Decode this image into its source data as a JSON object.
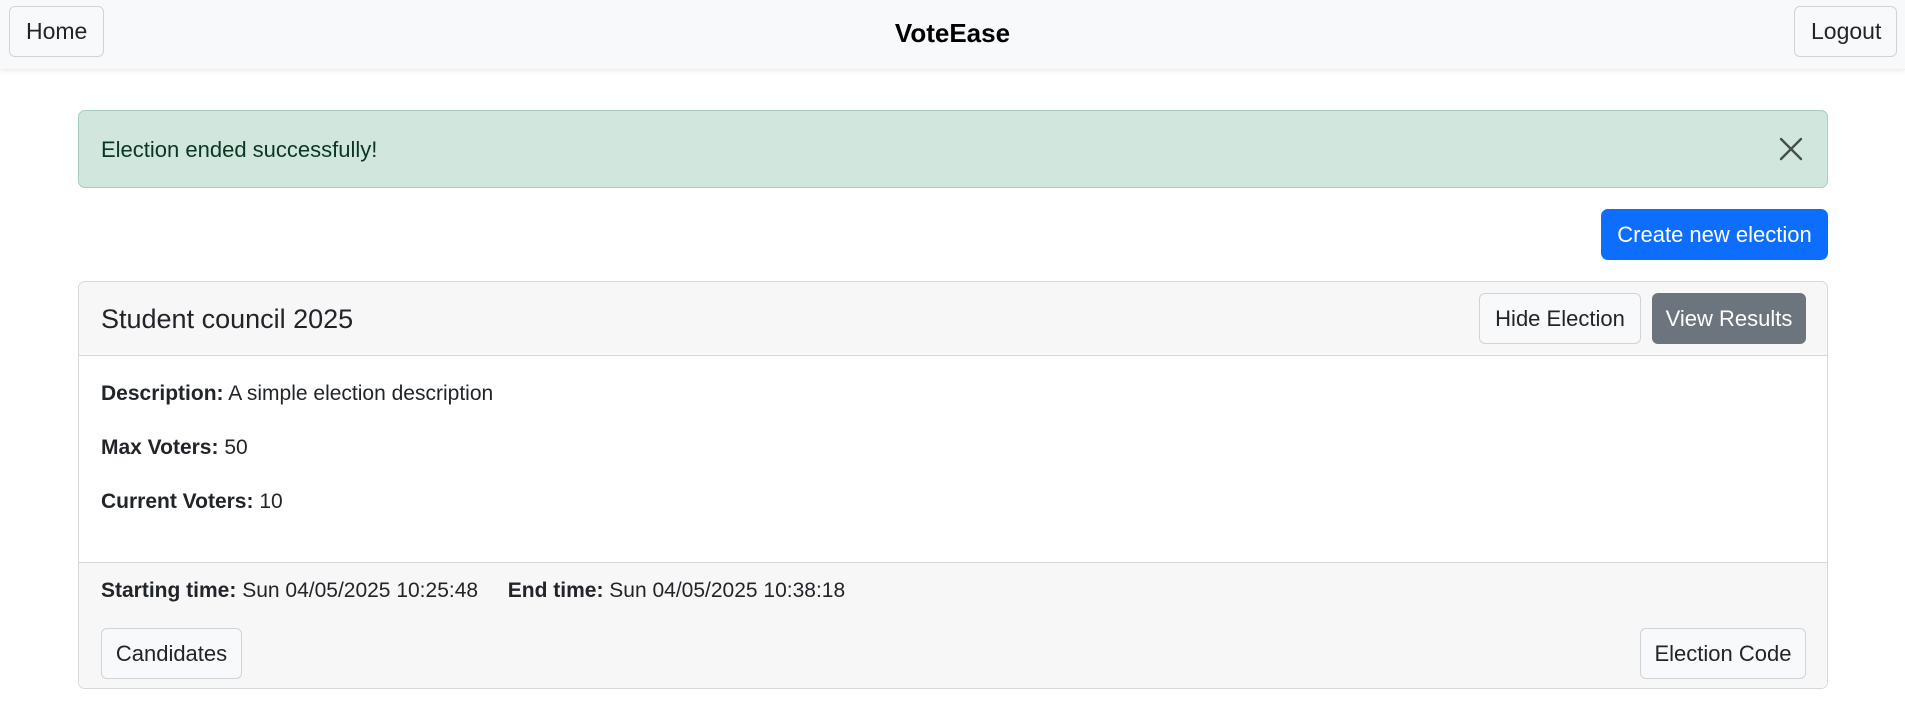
{
  "navbar": {
    "home_label": "Home",
    "brand": "VoteEase",
    "logout_label": "Logout"
  },
  "alert": {
    "message": "Election ended successfully!",
    "close_icon": "close-icon",
    "color": "#d1e7dd"
  },
  "actions": {
    "create_label": "Create new election",
    "accent_color": "#0d6efd"
  },
  "election": {
    "title": "Student council 2025",
    "hide_label": "Hide Election",
    "results_label": "View Results",
    "description_label": "Description:",
    "description_value": "A simple election description",
    "max_voters_label": "Max Voters:",
    "max_voters_value": "50",
    "current_voters_label": "Current Voters:",
    "current_voters_value": "10",
    "start_label": "Starting time:",
    "start_value": "Sun 04/05/2025 10:25:48",
    "end_label": "End time:",
    "end_value": "Sun 04/05/2025 10:38:18",
    "candidates_label": "Candidates",
    "code_label": "Election Code"
  }
}
